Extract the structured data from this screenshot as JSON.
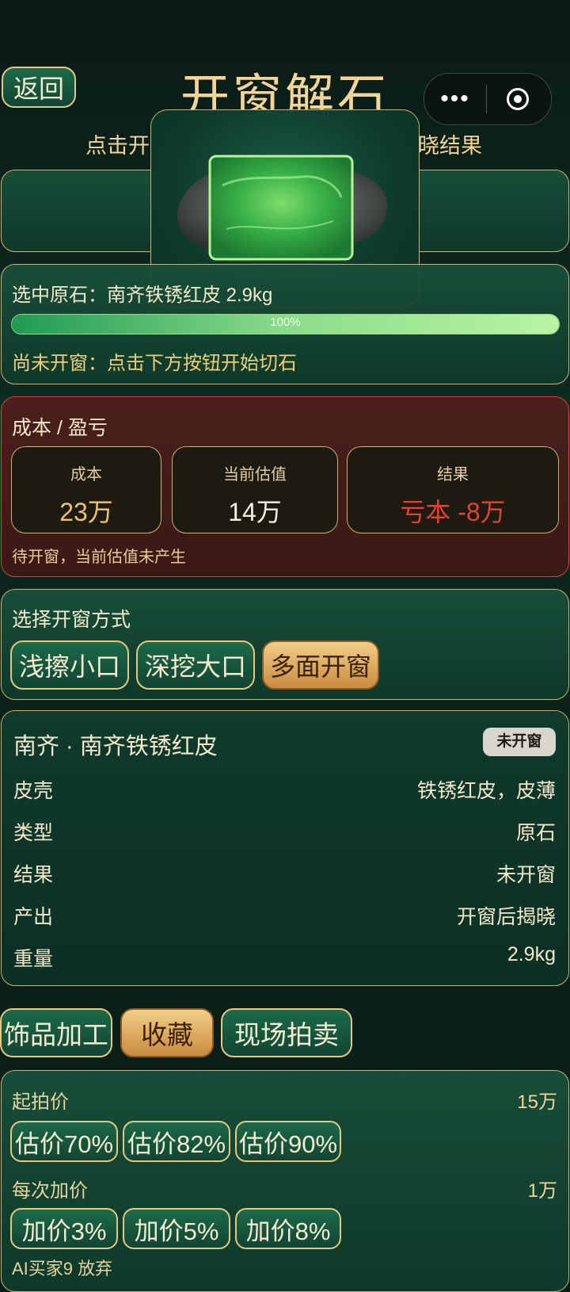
{
  "header": {
    "back_label": "返回",
    "title": "开窗解石",
    "more_label": "•••"
  },
  "hint": {
    "left": "点击开",
    "right": "晓结果"
  },
  "selected": {
    "label": "选中原石：南齐铁锈红皮 2.9kg",
    "progress_text": "100%",
    "progress_value": 1.0,
    "status": "尚未开窗：点击下方按钮开始切石"
  },
  "cost": {
    "title": "成本 / 盈亏",
    "stats": [
      {
        "label": "成本",
        "value": "23万"
      },
      {
        "label": "当前估值",
        "value": "14万"
      },
      {
        "label": "结果",
        "value": "亏本 -8万"
      }
    ],
    "note": "待开窗，当前估值未产生",
    "colors": {
      "cost": "#f0c36a",
      "estimate": "#f7efe0",
      "result": "#e2422f"
    }
  },
  "method": {
    "title": "选择开窗方式",
    "options": [
      "浅擦小口",
      "深挖大口",
      "多面开窗"
    ],
    "selected_index": 2
  },
  "info": {
    "title": "南齐 · 南齐铁锈红皮",
    "badge": "未开窗",
    "rows": [
      {
        "label": "皮壳",
        "value": "铁锈红皮，皮薄"
      },
      {
        "label": "类型",
        "value": "原石"
      },
      {
        "label": "结果",
        "value": "未开窗"
      },
      {
        "label": "产出",
        "value": "开窗后揭晓"
      },
      {
        "label": "重量",
        "value": "2.9kg"
      }
    ]
  },
  "actions": {
    "tabs": [
      "饰品加工",
      "收藏",
      "现场拍卖"
    ],
    "selected_index": 1
  },
  "auction": {
    "start_label": "起拍价",
    "start_value": "15万",
    "start_options": [
      "估价70%",
      "估价82%",
      "估价90%"
    ],
    "increment_label": "每次加价",
    "increment_value": "1万",
    "increment_options": [
      "加价3%",
      "加价5%",
      "加价8%"
    ],
    "log_text": "AI买家9 放弃"
  }
}
